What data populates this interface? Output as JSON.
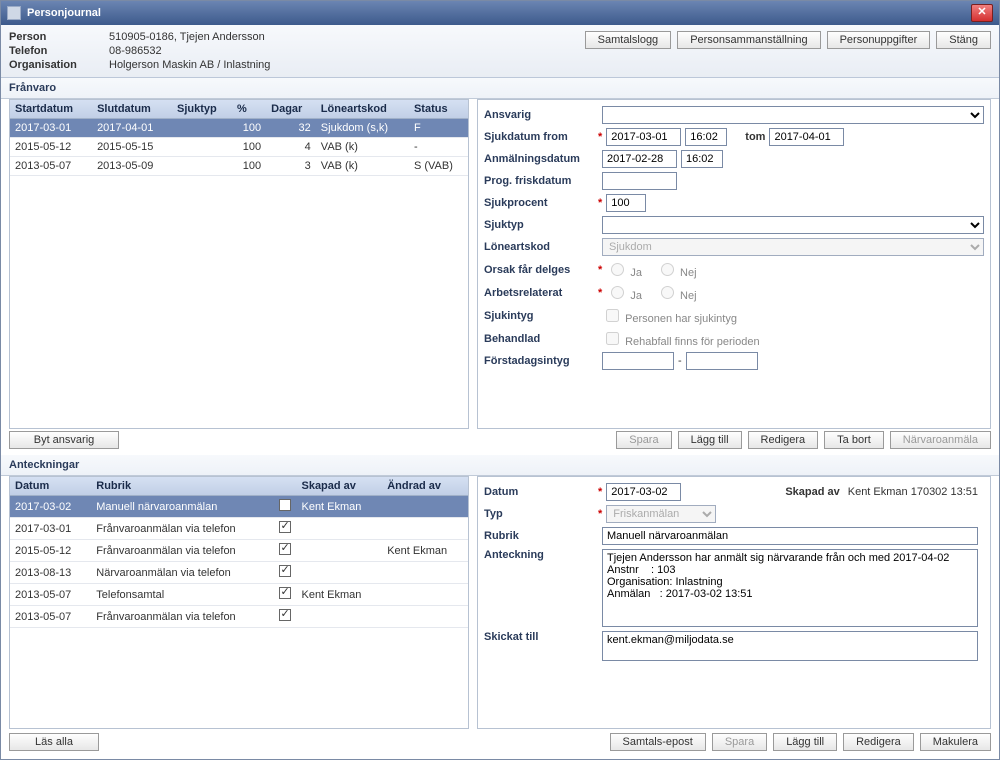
{
  "window_title": "Personjournal",
  "header": {
    "person_label": "Person",
    "person_value": "510905-0186, Tjejen Andersson",
    "telefon_label": "Telefon",
    "telefon_value": "08-986532",
    "org_label": "Organisation",
    "org_value": "Holgerson Maskin AB / Inlastning",
    "buttons": {
      "samtalslogg": "Samtalslogg",
      "personsamman": "Personsammanställning",
      "personuppgifter": "Personuppgifter",
      "stang": "Stäng"
    }
  },
  "franvaro": {
    "title": "Frånvaro",
    "columns": {
      "start": "Startdatum",
      "slut": "Slutdatum",
      "sjuktyp": "Sjuktyp",
      "pct": "%",
      "dagar": "Dagar",
      "loneart": "Löneartskod",
      "status": "Status"
    },
    "rows": [
      {
        "start": "2017-03-01",
        "slut": "2017-04-01",
        "sjuktyp": "",
        "pct": "100",
        "dagar": "32",
        "loneart": "Sjukdom (s,k)",
        "status": "F",
        "selected": true
      },
      {
        "start": "2015-05-12",
        "slut": "2015-05-15",
        "sjuktyp": "",
        "pct": "100",
        "dagar": "4",
        "loneart": "VAB (k)",
        "status": "-",
        "selected": false
      },
      {
        "start": "2013-05-07",
        "slut": "2013-05-09",
        "sjuktyp": "",
        "pct": "100",
        "dagar": "3",
        "loneart": "VAB (k)",
        "status": "S (VAB)",
        "selected": false
      }
    ],
    "byt_ansvarig": "Byt ansvarig",
    "right": {
      "ansvarig_label": "Ansvarig",
      "sjukdatum_from_label": "Sjukdatum from",
      "from_date": "2017-03-01",
      "from_time": "16:02",
      "tom_label": "tom",
      "tom_date": "2017-04-01",
      "anmalningsdatum_label": "Anmälningsdatum",
      "anm_date": "2017-02-28",
      "anm_time": "16:02",
      "prog_label": "Prog. friskdatum",
      "prog_value": "",
      "sjukprocent_label": "Sjukprocent",
      "sjukprocent_value": "100",
      "sjuktyp_label": "Sjuktyp",
      "loneartskod_label": "Löneartskod",
      "loneartskod_value": "Sjukdom",
      "orsak_label": "Orsak får delges",
      "arbetsrelaterat_label": "Arbetsrelaterat",
      "ja": "Ja",
      "nej": "Nej",
      "sjukintyg_label": "Sjukintyg",
      "sjukintyg_text": "Personen har sjukintyg",
      "behandlad_label": "Behandlad",
      "behandlad_text": "Rehabfall finns för perioden",
      "forsta_label": "Förstadagsintyg",
      "buttons": {
        "spara": "Spara",
        "lagg_till": "Lägg till",
        "redigera": "Redigera",
        "ta_bort": "Ta bort",
        "narvaroanmala": "Närvaroanmäla"
      }
    }
  },
  "anteckningar": {
    "title": "Anteckningar",
    "columns": {
      "datum": "Datum",
      "rubrik": "Rubrik",
      "check": "",
      "skapad_av": "Skapad av",
      "andrad_av": "Ändrad av"
    },
    "rows": [
      {
        "datum": "2017-03-02",
        "rubrik": "Manuell närvaroanmälan",
        "checked": true,
        "skapad": "Kent Ekman",
        "andrad": "",
        "selected": true
      },
      {
        "datum": "2017-03-01",
        "rubrik": "Frånvaroanmälan via telefon",
        "checked": true,
        "skapad": "",
        "andrad": "",
        "selected": false
      },
      {
        "datum": "2015-05-12",
        "rubrik": "Frånvaroanmälan via telefon",
        "checked": true,
        "skapad": "",
        "andrad": "Kent Ekman",
        "selected": false
      },
      {
        "datum": "2013-08-13",
        "rubrik": "Närvaroanmälan via telefon",
        "checked": true,
        "skapad": "",
        "andrad": "",
        "selected": false
      },
      {
        "datum": "2013-05-07",
        "rubrik": "Telefonsamtal",
        "checked": true,
        "skapad": "Kent Ekman",
        "andrad": "",
        "selected": false
      },
      {
        "datum": "2013-05-07",
        "rubrik": "Frånvaroanmälan via telefon",
        "checked": true,
        "skapad": "",
        "andrad": "",
        "selected": false
      }
    ],
    "las_alla": "Läs alla",
    "right": {
      "datum_label": "Datum",
      "datum_value": "2017-03-02",
      "skapad_av_label": "Skapad av",
      "skapad_av_value": "Kent Ekman 170302 13:51",
      "typ_label": "Typ",
      "typ_value": "Friskanmälan",
      "rubrik_label": "Rubrik",
      "rubrik_value": "Manuell närvaroanmälan",
      "anteckning_label": "Anteckning",
      "anteckning_value": "Tjejen Andersson har anmält sig närvarande från och med 2017-04-02\nAnstnr    : 103\nOrganisation: Inlastning\nAnmälan   : 2017-03-02 13:51",
      "skickat_label": "Skickat till",
      "skickat_value": "kent.ekman@miljodata.se",
      "buttons": {
        "samtals_epost": "Samtals-epost",
        "spara": "Spara",
        "lagg_till": "Lägg till",
        "redigera": "Redigera",
        "makulera": "Makulera"
      }
    }
  }
}
